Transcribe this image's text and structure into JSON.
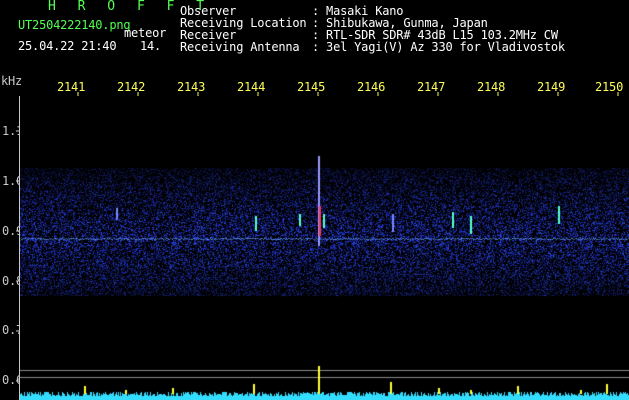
{
  "header": {
    "station_title": "H R O F F T",
    "filename": "UT2504222140.png",
    "mode": "meteor",
    "date_time": "25.04.22 21:40",
    "minute_label": "14.",
    "fields": [
      {
        "label": "Observer",
        "value": ": Masaki Kano"
      },
      {
        "label": "Receiving Location",
        "value": ": Shibukawa, Gunma, Japan"
      },
      {
        "label": "Receiver",
        "value": ": RTL-SDR SDR# 43dB L15 103.2MHz CW"
      },
      {
        "label": "Receiving Antenna",
        "value": ": 3el Yagi(V) Az 330 for Vladivostok"
      }
    ]
  },
  "time_axis": {
    "labels": [
      "2141",
      "2142",
      "2143",
      "2144",
      "2145",
      "2146",
      "2147",
      "2148",
      "2149",
      "2150"
    ]
  },
  "freq_axis": {
    "unit": "kHz",
    "labels": [
      "1.1",
      "1.0",
      "0.9",
      "0.8",
      "0.7",
      "0.6"
    ]
  },
  "colors": {
    "background": "#000000",
    "header_text": "#ffffff",
    "title_text": "#55ff55",
    "time_labels": "#ffff55",
    "axis_text": "#c8c8c8",
    "noise": "#2a3aff",
    "carrier": "#66aaff",
    "meteor_strong": "#ff3355",
    "meteor_weak": "#55ffcc",
    "level_trace": "#33ddff",
    "level_peak": "#ffff33"
  }
}
